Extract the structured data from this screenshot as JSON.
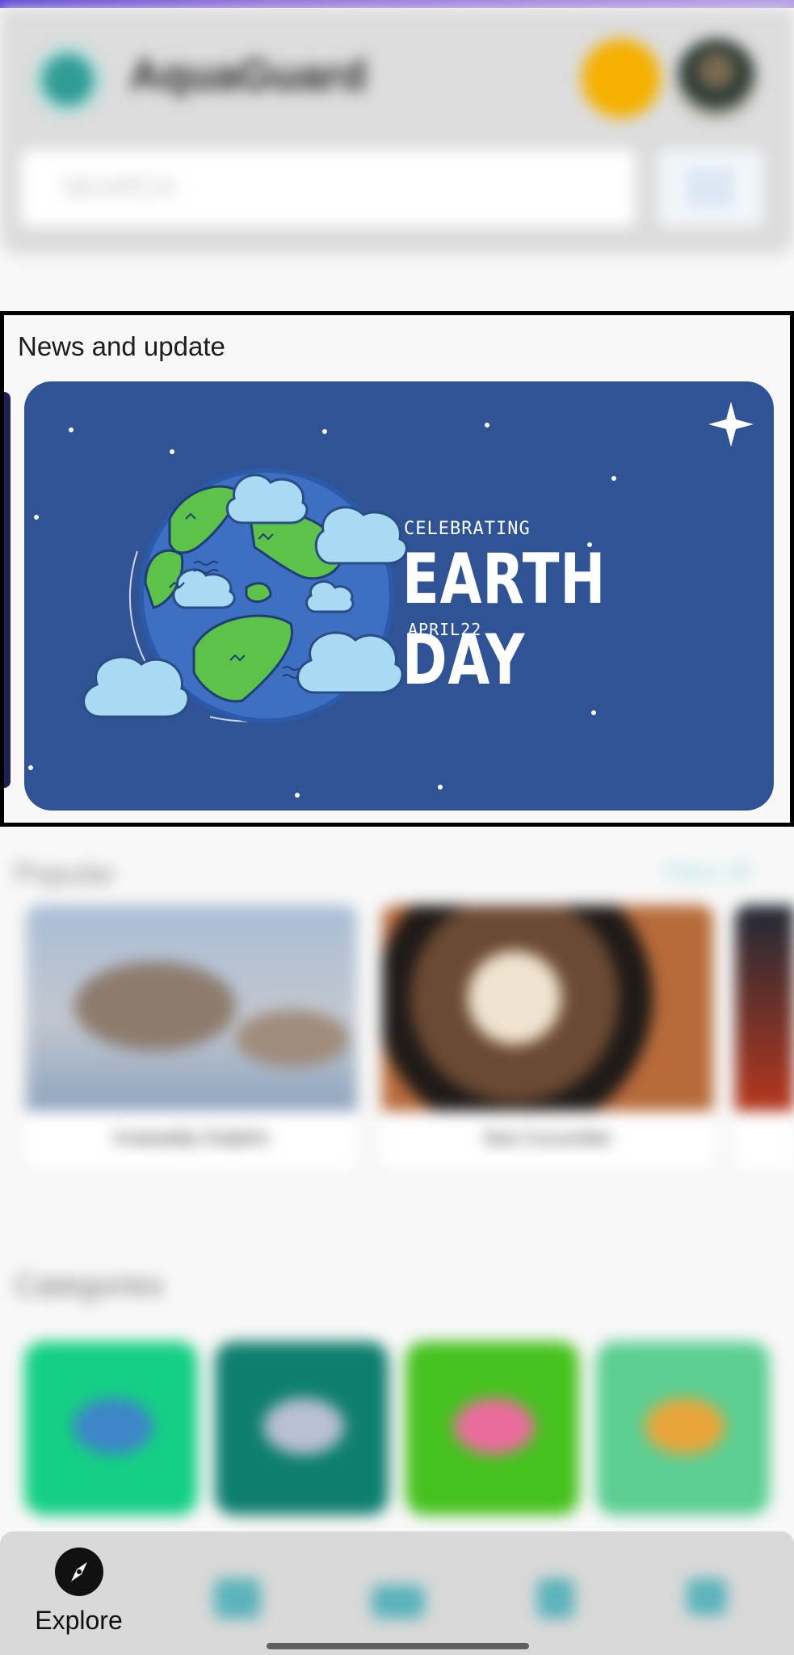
{
  "header": {
    "app_name": "AquaGuard",
    "search_placeholder": "SEARCH"
  },
  "news": {
    "title": "News and update",
    "card": {
      "caption_small": "CELEBRATING",
      "caption_big": "EARTH DAY",
      "caption_date": "APRIL22",
      "background_color": "#2f5394"
    }
  },
  "popular": {
    "heading": "Popular",
    "view_all": "View all",
    "items": [
      {
        "label": "Irrawaddy Dolphin"
      },
      {
        "label": "Sea Cucumber"
      }
    ]
  },
  "categories": {
    "heading": "Categories",
    "tiles": [
      {
        "icon": "dolphin-icon",
        "color": "#14cf84"
      },
      {
        "icon": "fish-icon",
        "color": "#0e7f6f"
      },
      {
        "icon": "crab-icon",
        "color": "#46c21f"
      },
      {
        "icon": "shell-icon",
        "color": "#5cce92"
      }
    ]
  },
  "bottom_nav": {
    "explore_label": "Explore"
  }
}
